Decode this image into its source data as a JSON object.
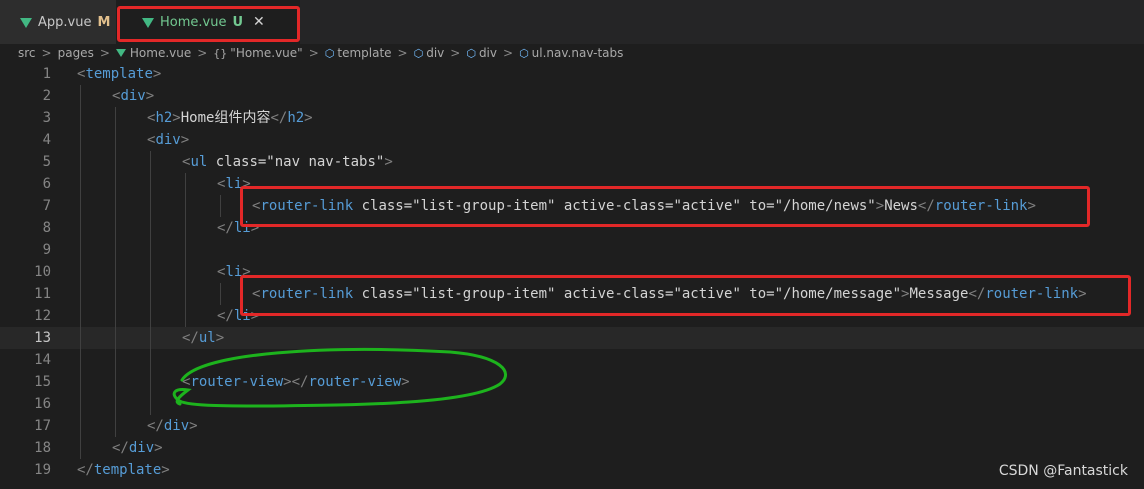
{
  "tabs": [
    {
      "label": "App.vue",
      "badge": "M"
    },
    {
      "label": "Home.vue",
      "badge": "U",
      "close": "✕"
    }
  ],
  "breadcrumb": {
    "items": [
      "src",
      "pages",
      "Home.vue",
      "\"Home.vue\"",
      "template",
      "div",
      "div",
      "ul.nav.nav-tabs"
    ],
    "separator": ">",
    "braces": "{}"
  },
  "editor": {
    "current_line": 13,
    "lines": [
      {
        "n": "1",
        "text": "<template>"
      },
      {
        "n": "2",
        "text": "<div>"
      },
      {
        "n": "3",
        "text": "<h2>Home组件内容</h2>"
      },
      {
        "n": "4",
        "text": "<div>"
      },
      {
        "n": "5",
        "text": "<ul class=\"nav nav-tabs\">"
      },
      {
        "n": "6",
        "text": "<li>"
      },
      {
        "n": "7",
        "text": "<router-link class=\"list-group-item\" active-class=\"active\" to=\"/home/news\">News</router-link>"
      },
      {
        "n": "8",
        "text": "</li>"
      },
      {
        "n": "9",
        "text": ""
      },
      {
        "n": "10",
        "text": "<li>"
      },
      {
        "n": "11",
        "text": "<router-link class=\"list-group-item\" active-class=\"active\" to=\"/home/message\">Message</router-link>"
      },
      {
        "n": "12",
        "text": "</li>"
      },
      {
        "n": "13",
        "text": "</ul>"
      },
      {
        "n": "14",
        "text": ""
      },
      {
        "n": "15",
        "text": "<router-view></router-view>"
      },
      {
        "n": "16",
        "text": ""
      },
      {
        "n": "17",
        "text": "</div>"
      },
      {
        "n": "18",
        "text": "</div>"
      },
      {
        "n": "19",
        "text": "</template>"
      }
    ]
  },
  "watermark": "CSDN @Fantastick",
  "colors": {
    "annotation_red": "#e32828",
    "annotation_green": "#1db31d",
    "vue_green": "#42b883",
    "modified": "#e2c08d",
    "untracked": "#73c991"
  }
}
